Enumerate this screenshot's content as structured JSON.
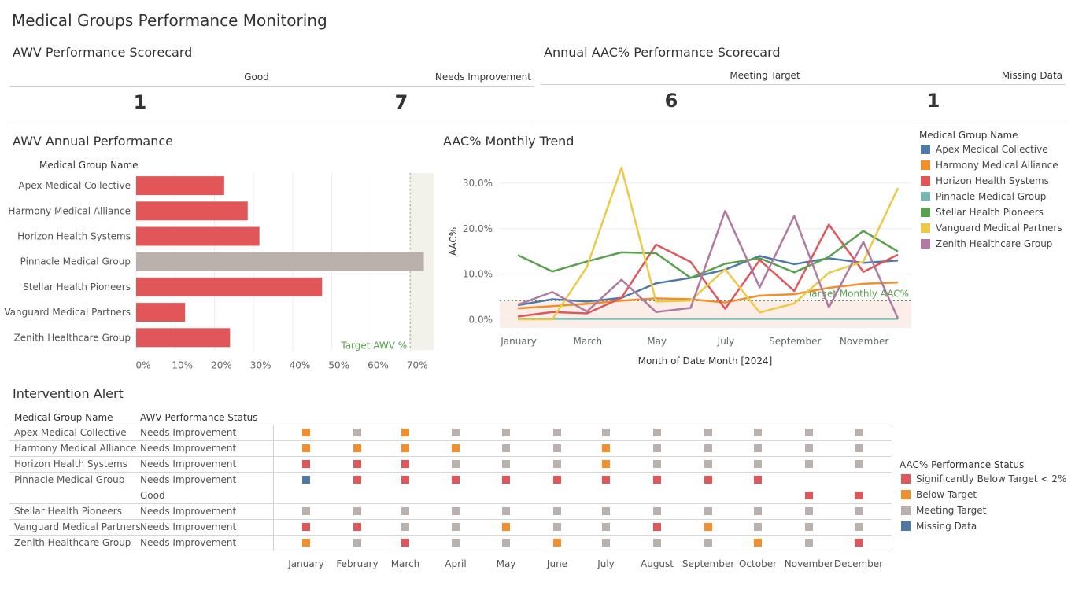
{
  "page_title": "Medical Groups Performance Monitoring",
  "colors": {
    "red": "#e15759",
    "orange": "#f28e2b",
    "grey": "#bab0ac",
    "blue": "#4e79a7",
    "green_target": "#59a14f"
  },
  "awv_scorecard": {
    "title": "AWV Performance Scorecard",
    "good_label": "Good",
    "good_value": "1",
    "needs_label": "Needs Improvement",
    "needs_value": "7"
  },
  "aac_scorecard": {
    "title": "Annual AAC% Performance Scorecard",
    "meeting_label": "Meeting Target",
    "meeting_value": "6",
    "missing_label": "Missing Data",
    "missing_value": "1"
  },
  "awv_annual": {
    "title": "AWV Annual Performance",
    "header": "Medical Group Name",
    "target_label": "Target AWV %",
    "chart_data": {
      "type": "bar",
      "categories": [
        "Apex Medical Collective",
        "Harmony Medical Alliance",
        "Horizon Health Systems",
        "Pinnacle Medical Group",
        "Stellar Health Pioneers",
        "Vanguard Medical Partners",
        "Zenith Healthcare Group"
      ],
      "values": [
        22.5,
        28.5,
        31.5,
        73.5,
        47.5,
        12.5,
        24
      ],
      "colors": [
        "red",
        "red",
        "red",
        "grey",
        "red",
        "red",
        "red"
      ],
      "xticks": [
        "0%",
        "10%",
        "20%",
        "30%",
        "40%",
        "50%",
        "60%",
        "70%"
      ],
      "xlim": [
        0,
        76
      ],
      "target": 70,
      "grid": true
    }
  },
  "aac_trend": {
    "title": "AAC% Monthly Trend",
    "ylabel": "AAC%",
    "xlabel": "Month of Date Month [2024]",
    "target_label": "Target Monthly AAC%",
    "legend_title": "Medical Group Name",
    "chart_data": {
      "type": "line",
      "x": [
        "January",
        "February",
        "March",
        "April",
        "May",
        "June",
        "July",
        "August",
        "September",
        "October",
        "November",
        "December"
      ],
      "xticks": [
        "January",
        "March",
        "May",
        "July",
        "September",
        "November"
      ],
      "yticks": [
        "30.0%",
        "20.0%",
        "10.0%",
        "0.0%"
      ],
      "ylim": [
        -1.8,
        35.5
      ],
      "target": 4.2,
      "series": [
        {
          "name": "Apex Medical Collective",
          "color": "#4e79a7",
          "values": [
            3.2,
            4.5,
            4.0,
            4.8,
            8.0,
            9.2,
            11.0,
            14.0,
            12.2,
            13.5,
            12.5,
            13.0
          ]
        },
        {
          "name": "Harmony Medical Alliance",
          "color": "#f28e2b",
          "values": [
            2.5,
            3.0,
            3.5,
            4.2,
            4.7,
            4.5,
            3.8,
            5.3,
            5.6,
            7.0,
            7.9,
            8.2
          ]
        },
        {
          "name": "Horizon Health Systems",
          "color": "#e15759",
          "values": [
            0.7,
            1.7,
            1.4,
            4.8,
            16.5,
            12.7,
            2.4,
            13.1,
            6.3,
            20.9,
            10.5,
            14.3
          ]
        },
        {
          "name": "Pinnacle Medical Group",
          "color": "#76b7b2",
          "values": [
            0.2,
            0.2,
            0.2,
            0.2,
            0.2,
            0.2,
            0.2,
            0.2,
            0.2,
            0.2,
            0.2,
            0.2
          ]
        },
        {
          "name": "Stellar Health Pioneers",
          "color": "#59a14f",
          "values": [
            14.2,
            10.6,
            12.8,
            14.8,
            14.6,
            9.2,
            12.3,
            13.5,
            10.4,
            13.8,
            19.5,
            15.0
          ]
        },
        {
          "name": "Vanguard Medical Partners",
          "color": "#edc948",
          "values": [
            0.1,
            0.1,
            11.6,
            33.4,
            4.0,
            4.2,
            11.1,
            1.6,
            3.6,
            10.3,
            12.8,
            28.9
          ]
        },
        {
          "name": "Zenith Healthcare Group",
          "color": "#b07aa1",
          "values": [
            3.3,
            6.1,
            1.8,
            8.8,
            1.7,
            2.6,
            23.9,
            7.1,
            22.8,
            2.7,
            17.1,
            0.3
          ]
        }
      ]
    }
  },
  "intervention": {
    "title": "Intervention Alert",
    "col_group": "Medical Group Name",
    "col_status": "AWV Performance Status",
    "months": [
      "January",
      "February",
      "March",
      "April",
      "May",
      "June",
      "July",
      "August",
      "September",
      "October",
      "November",
      "December"
    ],
    "rows": [
      {
        "group": "Apex Medical Collective",
        "status": "Needs Improvement",
        "cells": [
          "O",
          "G",
          "O",
          "G",
          "G",
          "G",
          "G",
          "G",
          "G",
          "G",
          "G",
          "G"
        ]
      },
      {
        "group": "Harmony Medical Alliance",
        "status": "Needs Improvement",
        "cells": [
          "O",
          "O",
          "O",
          "O",
          "G",
          "G",
          "O",
          "G",
          "G",
          "G",
          "G",
          "G"
        ]
      },
      {
        "group": "Horizon Health Systems",
        "status": "Needs Improvement",
        "cells": [
          "R",
          "R",
          "R",
          "G",
          "G",
          "G",
          "O",
          "G",
          "G",
          "G",
          "G",
          "G"
        ]
      },
      {
        "group": "Pinnacle Medical Group",
        "status": "Needs Improvement",
        "cells": [
          "B",
          "R",
          "R",
          "R",
          "R",
          "R",
          "R",
          "R",
          "R",
          "R",
          "",
          ""
        ]
      },
      {
        "group": "",
        "status": "Good",
        "cells": [
          "",
          "",
          "",
          "",
          "",
          "",
          "",
          "",
          "",
          "",
          "R",
          "R"
        ]
      },
      {
        "group": "Stellar Health Pioneers",
        "status": "Needs Improvement",
        "cells": [
          "G",
          "G",
          "G",
          "G",
          "G",
          "G",
          "G",
          "G",
          "G",
          "G",
          "G",
          "G"
        ]
      },
      {
        "group": "Vanguard Medical Partners",
        "status": "Needs Improvement",
        "cells": [
          "R",
          "R",
          "G",
          "G",
          "O",
          "G",
          "G",
          "R",
          "O",
          "G",
          "G",
          "G"
        ]
      },
      {
        "group": "Zenith Healthcare Group",
        "status": "Needs Improvement",
        "cells": [
          "O",
          "G",
          "R",
          "G",
          "G",
          "O",
          "G",
          "G",
          "G",
          "O",
          "G",
          "R"
        ]
      }
    ],
    "legend_title": "AAC% Performance Status",
    "legend": [
      {
        "label": "Significantly Below Target < 2%",
        "color": "#e15759"
      },
      {
        "label": "Below Target",
        "color": "#f28e2b"
      },
      {
        "label": "Meeting Target",
        "color": "#bab0ac"
      },
      {
        "label": "Missing Data",
        "color": "#4e79a7"
      }
    ]
  }
}
